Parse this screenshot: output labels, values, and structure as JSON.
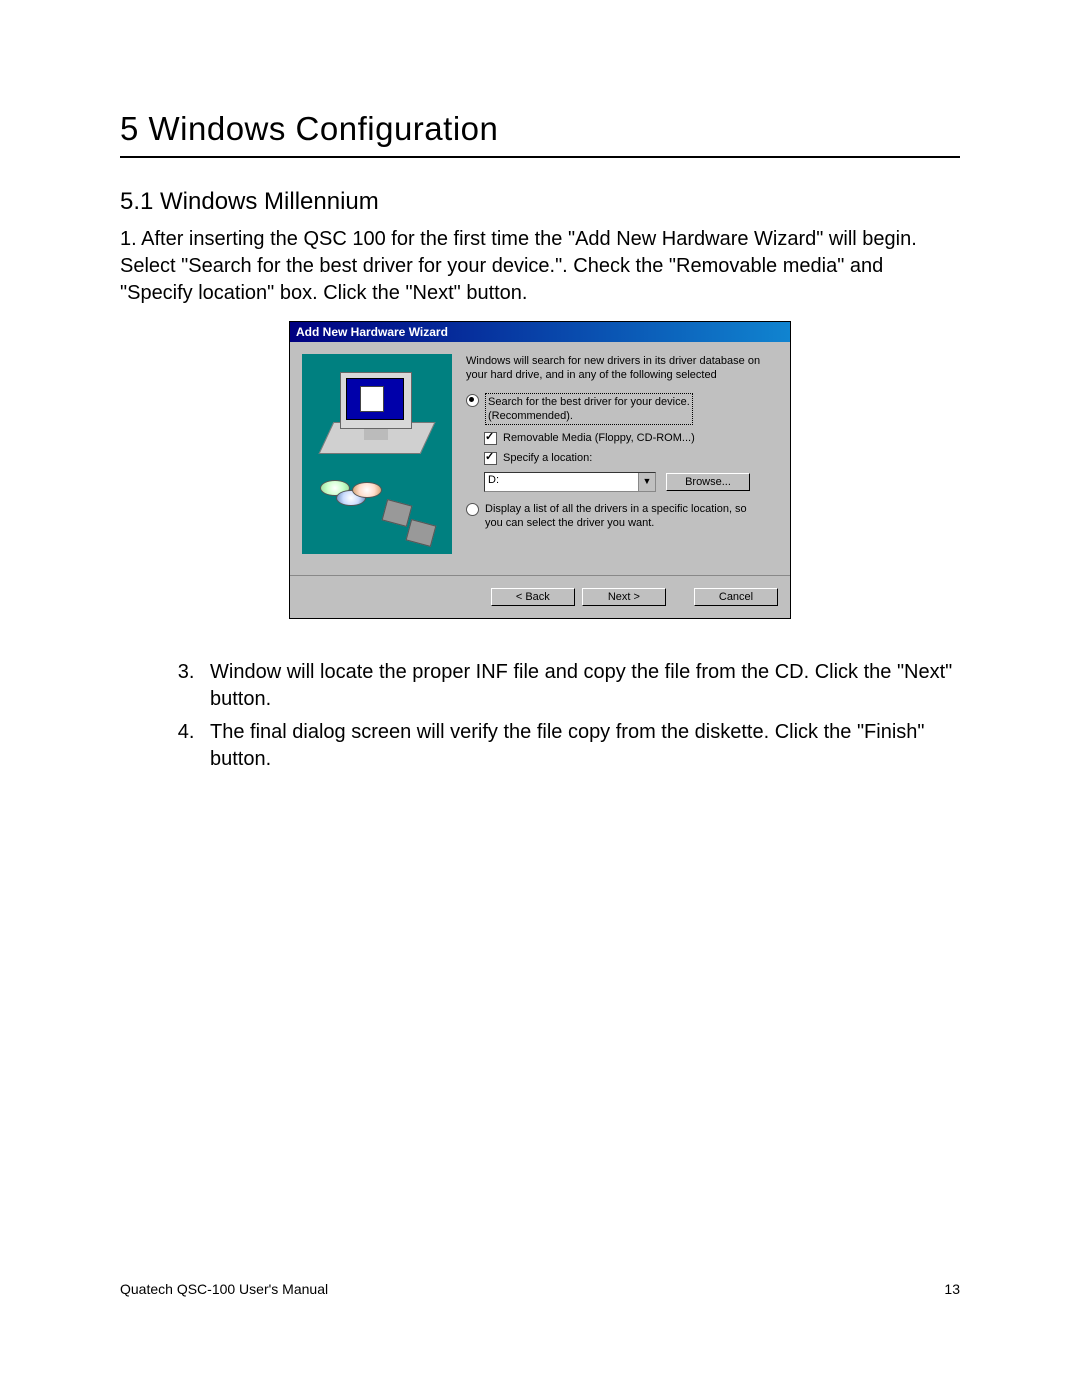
{
  "chapter_title": "5 Windows Configuration",
  "section_title": "5.1 Windows Millennium",
  "intro_paragraph": "1.      After inserting the QSC 100 for the first time the \"Add New Hardware Wizard\" will begin.  Select \"Search for the best driver for your device.\". Check the \"Removable media\" and \"Specify location\" box. Click the \"Next\" button.",
  "step3": "Window will locate the proper INF file and copy the file from the CD. Click the \"Next\" button.",
  "step4": "The final dialog screen will verify the file copy from the diskette. Click the \"Finish\" button.",
  "dialog": {
    "title": "Add New Hardware Wizard",
    "intro": "Windows will search for new drivers in its driver database on your hard drive, and in any of the following selected",
    "radio1_line1": "Search for the best driver for your device.",
    "radio1_line2": "(Recommended).",
    "check_removable": "Removable Media (Floppy, CD-ROM...)",
    "check_specify": "Specify a location:",
    "drive_value": "D:",
    "browse": "Browse...",
    "radio2_line1": "Display a list of all the drivers in a specific location, so",
    "radio2_line2": "you can select the driver you want.",
    "btn_back": "< Back",
    "btn_next": "Next >",
    "btn_cancel": "Cancel"
  },
  "footer_left": "Quatech QSC-100 User's Manual",
  "footer_right": "13"
}
